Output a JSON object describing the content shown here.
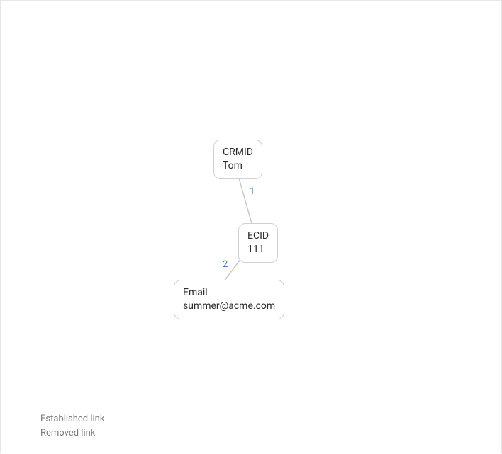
{
  "nodes": {
    "crmid": {
      "type": "CRMID",
      "value": "Tom"
    },
    "ecid": {
      "type": "ECID",
      "value": "111"
    },
    "email": {
      "type": "Email",
      "value": "summer@acme.com"
    }
  },
  "edges": {
    "e1": {
      "label": "1"
    },
    "e2": {
      "label": "2"
    }
  },
  "legend": {
    "established": "Established link",
    "removed": "Removed link"
  }
}
